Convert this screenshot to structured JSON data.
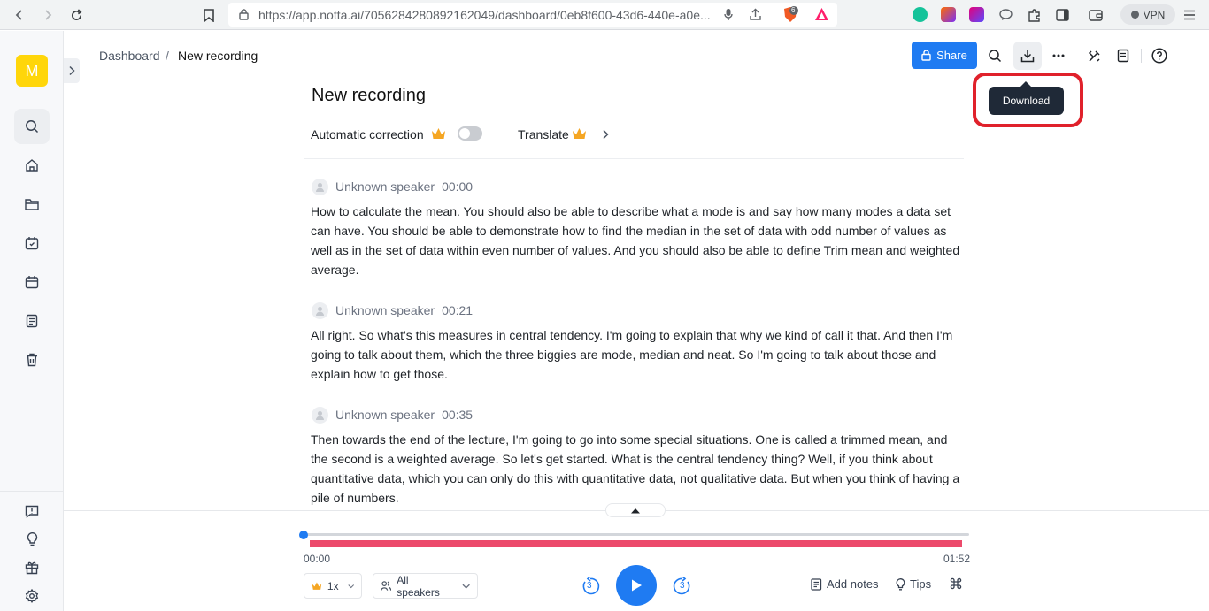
{
  "browser": {
    "url": "https://app.notta.ai/7056284280892162049/dashboard/0eb8f600-43d6-440e-a0e...",
    "brave_badge": "6",
    "vpn_label": "VPN"
  },
  "sidebar": {
    "avatar_letter": "M",
    "top_icons": [
      "search-icon",
      "home-icon",
      "folder-icon",
      "calendar-sync-icon",
      "calendar-icon",
      "notes-icon",
      "trash-icon"
    ],
    "bottom_icons": [
      "feedback-icon",
      "lightbulb-icon",
      "gift-icon",
      "settings-icon"
    ]
  },
  "header": {
    "breadcrumb_root": "Dashboard",
    "breadcrumb_sep": "/",
    "breadcrumb_current": "New recording",
    "share_label": "Share",
    "tooltip": "Download"
  },
  "document": {
    "title": "New recording",
    "auto_correction_label": "Automatic correction",
    "auto_correction_on": false,
    "translate_label": "Translate"
  },
  "segments": [
    {
      "speaker": "Unknown speaker",
      "time": "00:00",
      "text": "How to calculate the mean. You should also be able to describe what a mode is and say how many modes a data set can have. You should be able to demonstrate how to find the median in the set of data with odd number of values as well as in the set of data within even number of values. And you should also be able to define Trim mean and weighted average."
    },
    {
      "speaker": "Unknown speaker",
      "time": "00:21",
      "text": "All right. So what's this measures in central tendency. I'm going to explain that why we kind of call it that. And then I'm going to talk about them, which the three biggies are mode, median and neat. So I'm going to talk about those and explain how to get those."
    },
    {
      "speaker": "Unknown speaker",
      "time": "00:35",
      "text": "Then towards the end of the lecture, I'm going to go into some special situations. One is called a trimmed mean, and the second is a weighted average. So let's get started. What is the central tendency thing? Well, if you think about quantitative data, which you can only do this with quantitative data, not qualitative data. But when you think of having a pile of numbers."
    }
  ],
  "player": {
    "current_time": "00:00",
    "total_time": "01:52",
    "progress": 0,
    "speed": "1x",
    "speakers_filter": "All speakers",
    "skip_back": "3",
    "skip_forward": "3",
    "add_notes": "Add notes",
    "tips": "Tips"
  },
  "colors": {
    "accent": "#1f7bf2",
    "avatar": "#ffd60a",
    "waveform": "#ec4a6b",
    "highlight": "#e0212b"
  }
}
